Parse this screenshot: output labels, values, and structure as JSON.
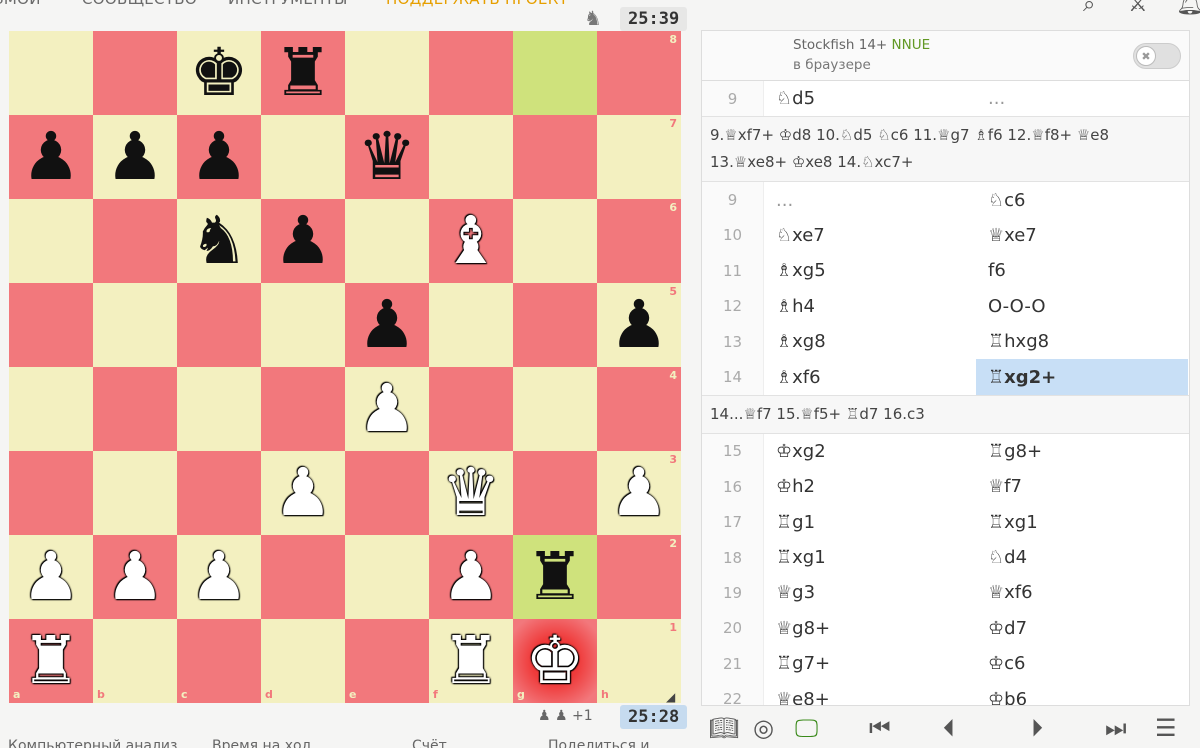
{
  "nav": {
    "items": [
      "ЗМОИ",
      "СООБЩЕСТВО",
      "ИНСТРУМЕНТЫ",
      "ПОДДЕРЖАТЬ ПРОЕКТ"
    ],
    "icons": [
      "search-icon",
      "tournament-icon",
      "notifications-icon"
    ]
  },
  "clocks": {
    "top": "25:39",
    "bottom": "25:28"
  },
  "material": "+1",
  "board": {
    "ranks": [
      "8",
      "7",
      "6",
      "5",
      "4",
      "3",
      "2",
      "1"
    ],
    "files": [
      "a",
      "b",
      "c",
      "d",
      "e",
      "f",
      "g",
      "h"
    ],
    "rows": [
      [
        "",
        "",
        "bk",
        "br",
        "",
        "",
        "",
        ""
      ],
      [
        "bp",
        "bp",
        "bp",
        "",
        "bq",
        "",
        "",
        ""
      ],
      [
        "",
        "",
        "bn",
        "bp",
        "",
        "wb",
        "",
        ""
      ],
      [
        "",
        "",
        "",
        "",
        "bp",
        "",
        "",
        "bp"
      ],
      [
        "",
        "",
        "",
        "",
        "wp",
        "",
        "",
        ""
      ],
      [
        "",
        "",
        "",
        "wp",
        "",
        "wq",
        "",
        "wp"
      ],
      [
        "wp",
        "wp",
        "wp",
        "",
        "",
        "wp",
        "br",
        ""
      ],
      [
        "wr",
        "",
        "",
        "",
        "",
        "wr",
        "wk",
        ""
      ]
    ],
    "last_move": [
      "g8",
      "g2"
    ],
    "check": "g1"
  },
  "engine": {
    "name": "Stockfish 14+",
    "nnue": "NNUE",
    "sub": "в браузере",
    "enabled": false
  },
  "moves": {
    "row_top": {
      "num": "9",
      "white": "♘d5",
      "black": "..."
    },
    "variation1": "9.♕xf7+ ♔d8 10.♘d5 ♘c6 11.♕g7 ♗f6 12.♕f8+ ♕e8 13.♕xe8+ ♔xe8 14.♘xc7+",
    "block1": [
      {
        "num": "9",
        "white": "...",
        "black": "♘c6"
      },
      {
        "num": "10",
        "white": "♘xe7",
        "black": "♕xe7"
      },
      {
        "num": "11",
        "white": "♗xg5",
        "black": "f6"
      },
      {
        "num": "12",
        "white": "♗h4",
        "black": "O-O-O"
      },
      {
        "num": "13",
        "white": "♗xg8",
        "black": "♖hxg8"
      },
      {
        "num": "14",
        "white": "♗xf6",
        "black": "♖xg2+"
      }
    ],
    "variation2": "14...♕f7 15.♕f5+ ♖d7 16.c3",
    "block2": [
      {
        "num": "15",
        "white": "♔xg2",
        "black": "♖g8+"
      },
      {
        "num": "16",
        "white": "♔h2",
        "black": "♕f7"
      },
      {
        "num": "17",
        "white": "♖g1",
        "black": "♖xg1"
      },
      {
        "num": "18",
        "white": "♖xg1",
        "black": "♘d4"
      },
      {
        "num": "19",
        "white": "♕g3",
        "black": "♕xf6"
      },
      {
        "num": "20",
        "white": "♕g8+",
        "black": "♔d7"
      },
      {
        "num": "21",
        "white": "♖g7+",
        "black": "♔c6"
      },
      {
        "num": "22",
        "white": "♕e8+",
        "black": "♔b6"
      }
    ]
  },
  "under_board": [
    "Компьютерный анализ",
    "Время на ход",
    "Счёт",
    "Поделиться и"
  ],
  "controls": [
    "book-icon",
    "target-icon",
    "computer-icon",
    "first-icon",
    "prev-icon",
    "next-icon",
    "last-icon",
    "menu-icon"
  ]
}
